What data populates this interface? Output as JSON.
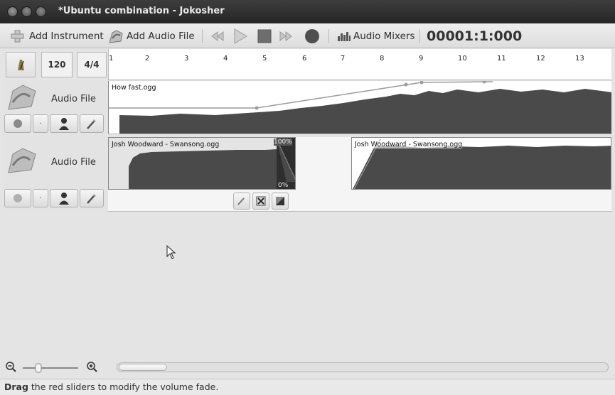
{
  "window": {
    "title": "*Ubuntu combination - Jokosher"
  },
  "toolbar": {
    "add_instrument": "Add Instrument",
    "add_audio_file": "Add Audio File",
    "audio_mixers": "Audio Mixers",
    "position": "00001:1:000"
  },
  "header": {
    "tempo": "120",
    "time_signature": "4/4"
  },
  "ruler": {
    "ticks": [
      "1",
      "2",
      "3",
      "4",
      "5",
      "6",
      "7",
      "8",
      "9",
      "10",
      "11",
      "12",
      "13"
    ]
  },
  "tracks": [
    {
      "name": "Audio File",
      "clips": [
        {
          "name": "How fast.ogg"
        }
      ]
    },
    {
      "name": "Audio File",
      "clips": [
        {
          "name": "Josh Woodward - Swansong.ogg",
          "fade_top": "100%",
          "fade_bottom": "0%"
        },
        {
          "name": "Josh Woodward - Swansong.ogg"
        }
      ]
    }
  ],
  "status": {
    "bold": "Drag",
    "text": " the red sliders to modify the volume fade."
  },
  "colors": {
    "titlebar": "#2e2e2e",
    "waveform": "#4a4a4a",
    "fade_line": "#9a9a9a"
  },
  "icons": [
    "add-instrument-icon",
    "add-audio-file-icon",
    "rewind-icon",
    "play-icon",
    "stop-icon",
    "fast-forward-icon",
    "record-icon",
    "audio-mixers-icon",
    "metronome-icon",
    "instrument-icon",
    "record-arm-icon",
    "solo-icon",
    "effects-icon",
    "zoom-out-icon",
    "zoom-in-icon",
    "cursor-icon"
  ]
}
